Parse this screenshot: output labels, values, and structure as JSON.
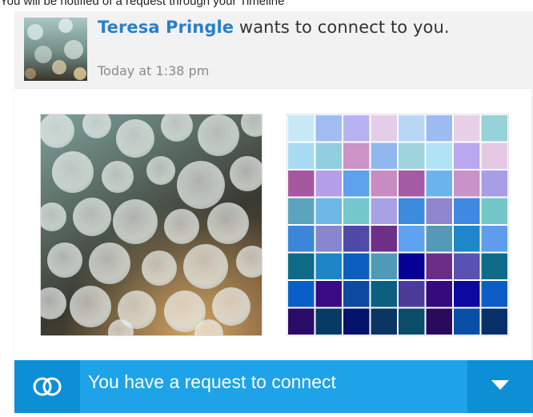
{
  "page_caption": "You will be notified of a request through your Timeline",
  "notification": {
    "requester_name": "Teresa Pringle",
    "message": " wants to connect to you.",
    "timestamp": "Today at 1:38 pm"
  },
  "request_bar": {
    "text": "You have a request to connect",
    "icon": "connect-rings-icon",
    "dropdown_icon": "caret-down-icon"
  },
  "colors": {
    "accent_blue": "#1ea3e8",
    "accent_dark": "#0d8fd6",
    "link_blue": "#2a80c8"
  }
}
